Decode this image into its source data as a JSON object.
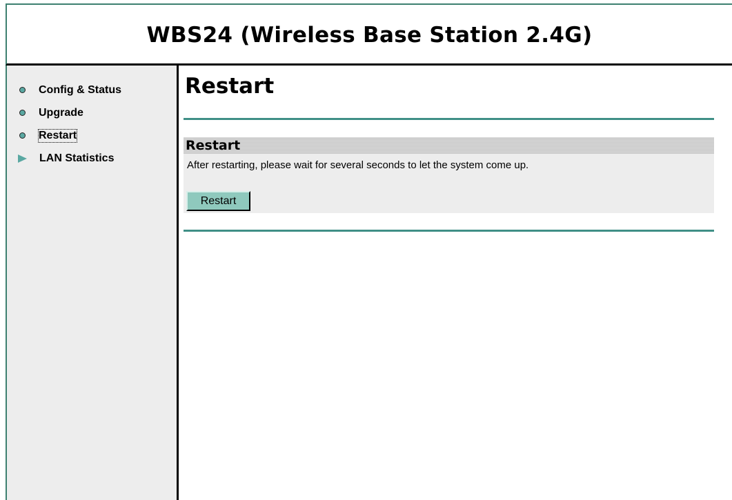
{
  "header": {
    "title": "WBS24 (Wireless Base Station 2.4G)"
  },
  "sidebar": {
    "items": [
      {
        "label": "Config & Status",
        "icon": "bullet-icon"
      },
      {
        "label": "Upgrade",
        "icon": "bullet-icon"
      },
      {
        "label": "Restart",
        "icon": "bullet-icon",
        "focused": true
      },
      {
        "label": "LAN Statistics",
        "icon": "arrow-right-icon"
      }
    ]
  },
  "main": {
    "page_title": "Restart",
    "panel": {
      "heading": "Restart",
      "description": "After restarting, please wait for several seconds to let the system come up.",
      "button_label": "Restart"
    }
  },
  "colors": {
    "frame_border": "#3c7f6f",
    "accent": "#5aa8a2",
    "rule": "#3f8f86",
    "button": "#8fc9bd",
    "sidebar_bg": "#ededed"
  }
}
